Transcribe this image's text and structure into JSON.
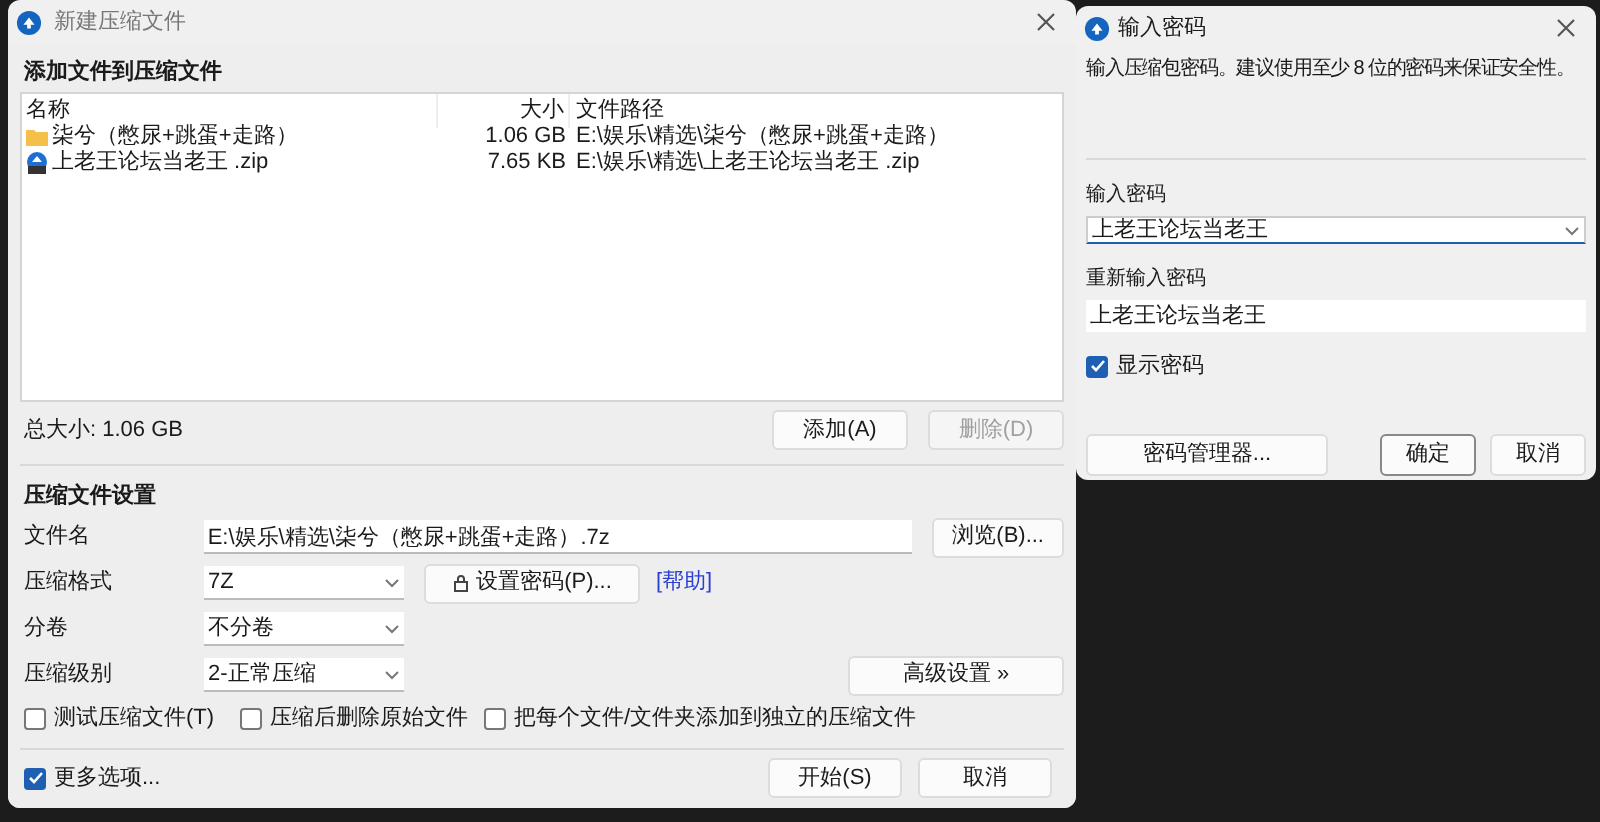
{
  "main_window": {
    "title": "新建压缩文件",
    "files": {
      "heading": "添加文件到压缩文件",
      "columns": [
        "名称",
        "大小",
        "文件路径"
      ],
      "rows": [
        {
          "kind": "folder",
          "name": "柒兮（憋尿+跳蛋+走路）",
          "size": "1.06 GB",
          "path": "E:\\娱乐\\精选\\柒兮（憋尿+跳蛋+走路）"
        },
        {
          "kind": "archive",
          "name": "上老王论坛当老王 .zip",
          "size": "7.65 KB",
          "path": "E:\\娱乐\\精选\\上老王论坛当老王 .zip"
        }
      ],
      "total_size": "总大小: 1.06 GB",
      "buttons": [
        {
          "label": "添加(A)",
          "disabled": false
        },
        {
          "label": "删除(D)",
          "disabled": true
        }
      ]
    },
    "settings": {
      "heading": "压缩文件设置",
      "filename": {
        "label": "文件名",
        "value": "E:\\娱乐\\精选\\柒兮（憋尿+跳蛋+走路）.7z"
      },
      "browse_button": "浏览(B)...",
      "format": {
        "label": "压缩格式",
        "value": "7Z"
      },
      "password_button": "设置密码(P)...",
      "help_link": "[帮助]",
      "volume": {
        "label": "分卷",
        "value": "不分卷"
      },
      "level": {
        "label": "压缩级别",
        "value": "2-正常压缩"
      },
      "advanced_button": "高级设置 »",
      "options": [
        {
          "label": "测试压缩文件(T)",
          "checked": false
        },
        {
          "label": "压缩后删除原始文件",
          "checked": false
        },
        {
          "label": "把每个文件/文件夹添加到独立的压缩文件",
          "checked": false
        }
      ]
    },
    "footer": {
      "more_options": {
        "label": "更多选项...",
        "checked": true
      },
      "buttons": [
        {
          "label": "开始(S)"
        },
        {
          "label": "取消"
        }
      ]
    }
  },
  "password_dialog": {
    "title": "输入密码",
    "hint": "输入压缩包密码。建议使用至少 8 位的密码来保证安全性。",
    "password": {
      "label": "输入密码",
      "value": "上老王论坛当老王"
    },
    "confirm": {
      "label": "重新输入密码",
      "value": "上老王论坛当老王"
    },
    "show_password": {
      "label": "显示密码",
      "checked": true
    },
    "manager_button": "密码管理器...",
    "buttons": [
      {
        "label": "确定",
        "default": true
      },
      {
        "label": "取消",
        "default": false
      }
    ]
  }
}
